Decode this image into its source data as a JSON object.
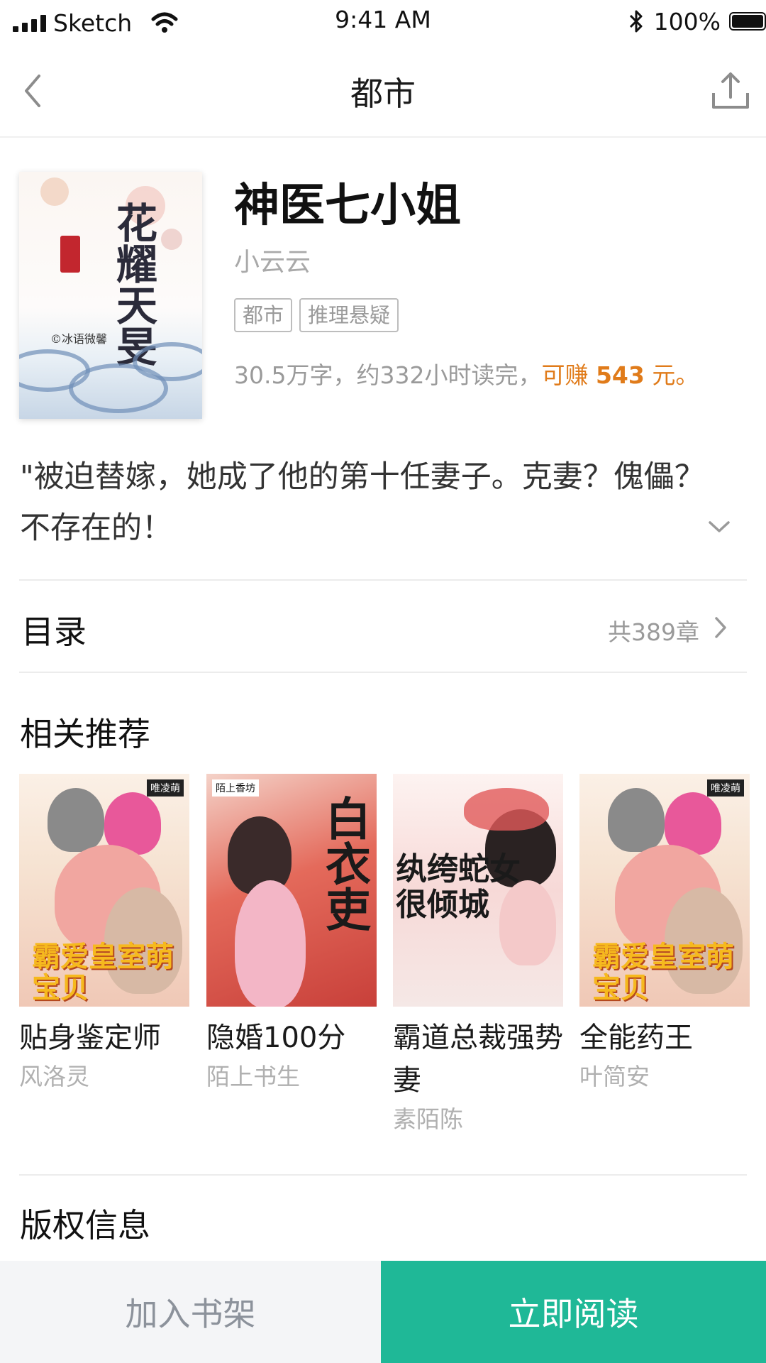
{
  "status_bar": {
    "carrier": "Sketch",
    "time": "9:41 AM",
    "battery_percent": "100%"
  },
  "nav": {
    "title": "都市",
    "back_icon": "chevron-left-icon",
    "share_icon": "share-upload-icon"
  },
  "book": {
    "cover_title": "花耀天旻",
    "cover_author": "©冰语微馨",
    "title": "神医七小姐",
    "author": "小云云",
    "tags": [
      "都市",
      "推理悬疑"
    ],
    "stats_prefix": "30.5万字，约332小时读完，",
    "earn_label": "可赚 ",
    "earn_amount": "543",
    "earn_suffix": " 元。"
  },
  "description": {
    "text": "\"被迫替嫁，她成了他的第十任妻子。克妻？傀儡？不存在的！"
  },
  "toc": {
    "label": "目录",
    "count": "共389章"
  },
  "recommendations": {
    "heading": "相关推荐",
    "items": [
      {
        "title": "贴身鉴定师",
        "author": "风洛灵",
        "cover_text": "霸爱皇室萌宝贝",
        "brand": "唯凌萌"
      },
      {
        "title": "隐婚100分",
        "author": "陌上书生",
        "cover_text": "白衣吏",
        "brand": "陌上香坊"
      },
      {
        "title": "霸道总裁强势妻",
        "author": "素陌陈",
        "cover_text": "纨绔蛇女很倾城",
        "brand": ""
      },
      {
        "title": "全能药王",
        "author": "叶简安",
        "cover_text": "霸爱皇室萌宝贝",
        "brand": "唯凌萌"
      }
    ]
  },
  "copyright": {
    "heading": "版权信息"
  },
  "actions": {
    "add_to_shelf": "加入书架",
    "read_now": "立即阅读"
  },
  "colors": {
    "accent": "#1fb897",
    "earn": "#e07b1a",
    "muted": "#9a9a9a"
  }
}
